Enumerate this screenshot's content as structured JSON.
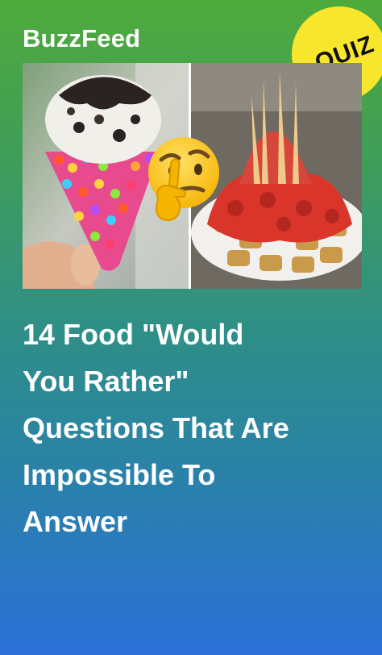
{
  "brand": {
    "name": "BuzzFeed"
  },
  "badge": {
    "label": "QUIZ"
  },
  "images": {
    "left": "ice-cream-cone-cereal-coated",
    "right": "pepperoni-cheese-tater-tots",
    "emoji": "thinking-face-emoji"
  },
  "headline": {
    "lines": [
      "14 Food \"Would",
      "You Rather\"",
      "Questions That Are",
      "Impossible To",
      "Answer"
    ]
  },
  "colors": {
    "gradient_top": "#4faa3c",
    "gradient_bottom": "#2b6fd8",
    "badge": "#f7e62b",
    "text": "#ffffff"
  }
}
